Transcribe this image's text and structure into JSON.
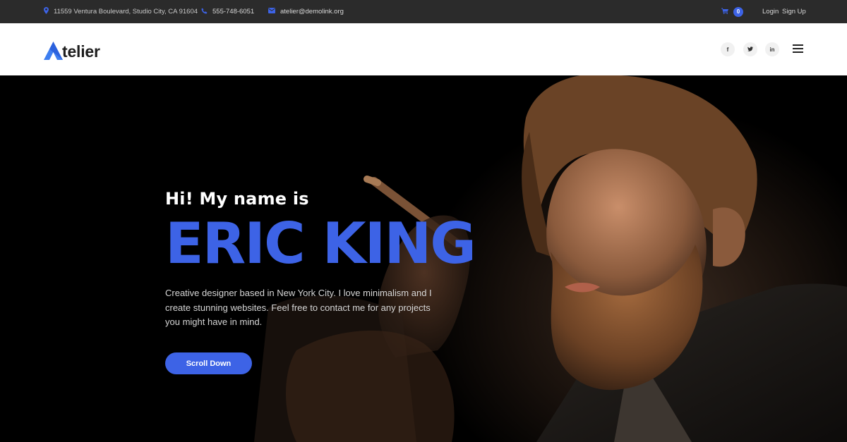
{
  "topbar": {
    "address": "11559 Ventura Boulevard, Studio City, CA 91604",
    "phone": "555-748-6051",
    "email": "atelier@demolink.org",
    "cart_count": "0",
    "login": "Login",
    "signup": "Sign Up",
    "icons": [
      "location-icon",
      "phone-icon",
      "mail-icon",
      "cart-icon"
    ]
  },
  "header": {
    "logo_letter": "A",
    "logo_text": "telier",
    "social": [
      {
        "name": "facebook-icon",
        "glyph": "f"
      },
      {
        "name": "twitter-icon",
        "glyph": "t"
      },
      {
        "name": "linkedin-icon",
        "glyph": "in"
      }
    ]
  },
  "hero": {
    "greeting": "Hi! My name is",
    "name": "ERIC KING",
    "description": "Creative designer based in New York City. I love minimalism and I create stunning websites. Feel free to contact me for any projects you might have in mind.",
    "button": "Scroll Down"
  },
  "colors": {
    "accent": "#3d63e6",
    "topbar_bg": "#2b2b2b",
    "header_bg": "#ffffff",
    "hero_bg": "#000000"
  }
}
